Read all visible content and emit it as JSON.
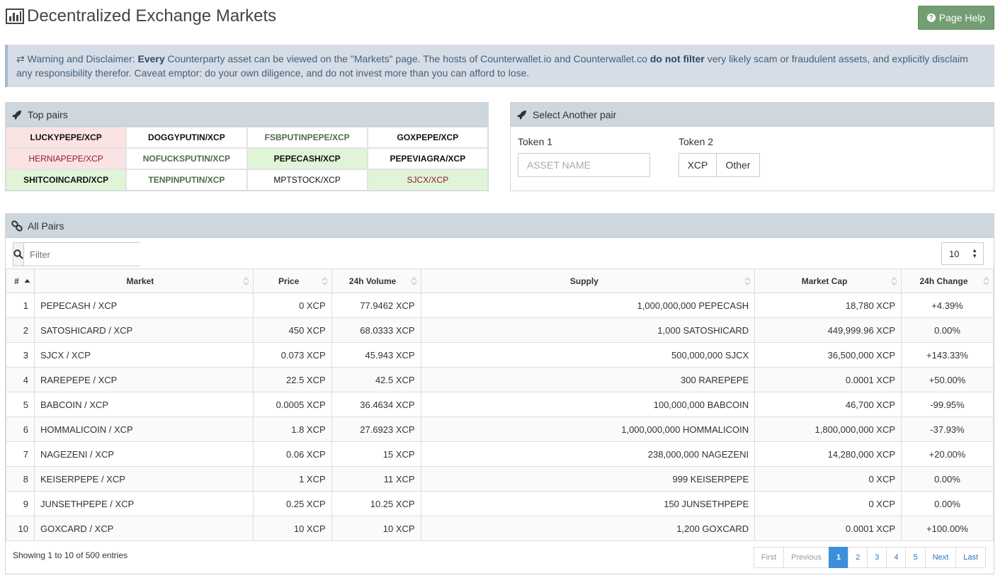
{
  "header": {
    "title": "Decentralized Exchange Markets",
    "help_label": "Page Help"
  },
  "warning": {
    "lead": "Warning and Disclaimer:",
    "every": "Every",
    "text1": "Counterparty asset can be viewed on the \"Markets\" page. The hosts of Counterwallet.io and Counterwallet.co",
    "bold2": "do not filter",
    "text2": "very likely scam or fraudulent assets, and explicitly disclaim any responsibility therefor. Caveat emptor: do your own diligence, and do not invest more than you can afford to lose."
  },
  "top_pairs": {
    "title": "Top pairs",
    "pairs": [
      "LUCKYPEPE/XCP",
      "DOGGYPUTIN/XCP",
      "FSBPUTINPEPE/XCP",
      "GOXPEPE/XCP",
      "HERNIAPEPE/XCP",
      "NOFUCKSPUTIN/XCP",
      "PEPECASH/XCP",
      "PEPEVIAGRA/XCP",
      "SHITCOINCARD/XCP",
      "TENPINPUTIN/XCP",
      "MPTSTOCK/XCP",
      "SJCX/XCP"
    ]
  },
  "select_pair": {
    "title": "Select Another pair",
    "token1_label": "Token 1",
    "token1_placeholder": "ASSET NAME",
    "token2_label": "Token 2",
    "token2_options": [
      "XCP",
      "Other"
    ]
  },
  "all_pairs": {
    "title": "All Pairs",
    "filter_placeholder": "Filter",
    "page_size": "10",
    "columns": [
      "#",
      "Market",
      "Price",
      "24h Volume",
      "Supply",
      "Market Cap",
      "24h Change"
    ],
    "rows": [
      [
        "1",
        "PEPECASH / XCP",
        "0 XCP",
        "77.9462 XCP",
        "1,000,000,000 PEPECASH",
        "18,780 XCP",
        "+4.39%"
      ],
      [
        "2",
        "SATOSHICARD / XCP",
        "450 XCP",
        "68.0333 XCP",
        "1,000 SATOSHICARD",
        "449,999.96 XCP",
        "0.00%"
      ],
      [
        "3",
        "SJCX / XCP",
        "0.073 XCP",
        "45.943 XCP",
        "500,000,000 SJCX",
        "36,500,000 XCP",
        "+143.33%"
      ],
      [
        "4",
        "RAREPEPE / XCP",
        "22.5 XCP",
        "42.5 XCP",
        "300 RAREPEPE",
        "0.0001 XCP",
        "+50.00%"
      ],
      [
        "5",
        "BABCOIN / XCP",
        "0.0005 XCP",
        "36.4634 XCP",
        "100,000,000 BABCOIN",
        "46,700 XCP",
        "-99.95%"
      ],
      [
        "6",
        "HOMMALICOIN / XCP",
        "1.8 XCP",
        "27.6923 XCP",
        "1,000,000,000 HOMMALICOIN",
        "1,800,000,000 XCP",
        "-37.93%"
      ],
      [
        "7",
        "NAGEZENI / XCP",
        "0.06 XCP",
        "15 XCP",
        "238,000,000 NAGEZENI",
        "14,280,000 XCP",
        "+20.00%"
      ],
      [
        "8",
        "KEISERPEPE / XCP",
        "1 XCP",
        "11 XCP",
        "999 KEISERPEPE",
        "0 XCP",
        "0.00%"
      ],
      [
        "9",
        "JUNSETHPEPE / XCP",
        "0.25 XCP",
        "10.25 XCP",
        "150 JUNSETHPEPE",
        "0 XCP",
        "0.00%"
      ],
      [
        "10",
        "GOXCARD / XCP",
        "10 XCP",
        "10 XCP",
        "1,200 GOXCARD",
        "0.0001 XCP",
        "+100.00%"
      ]
    ],
    "info": "Showing 1 to 10 of 500 entries",
    "pager": [
      "First",
      "Previous",
      "1",
      "2",
      "3",
      "4",
      "5",
      "Next",
      "Last"
    ]
  },
  "colors": {
    "help_button": "#739e73",
    "warning_bg": "#d6dde7",
    "panel_head": "#cdd7dd",
    "positive": "#2e8b2e",
    "negative": "#d9231d",
    "active_page": "#3b8fdc"
  }
}
